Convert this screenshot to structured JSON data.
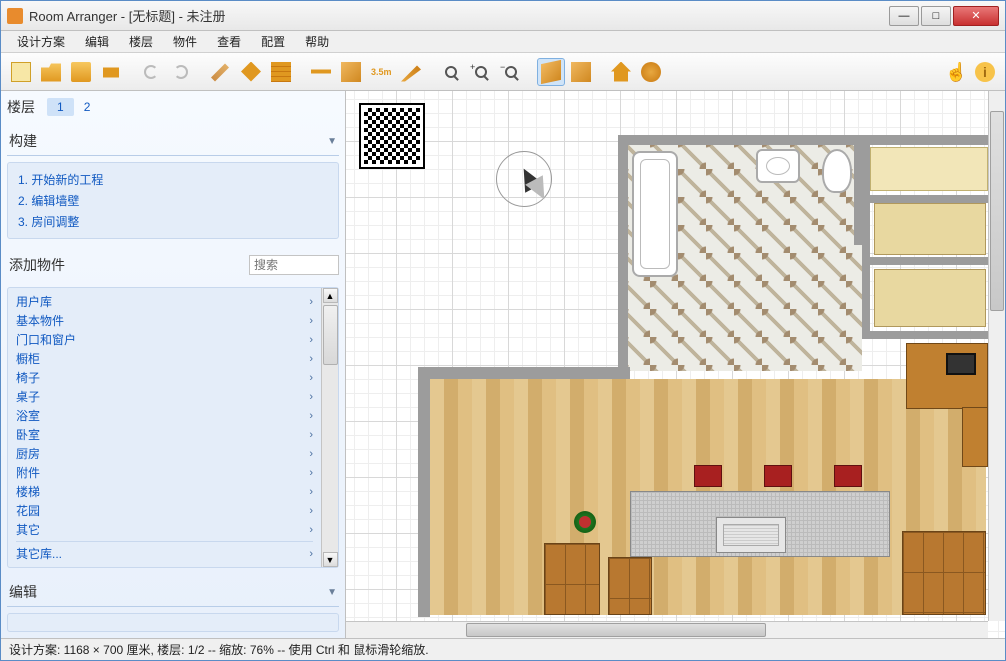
{
  "titlebar": {
    "app": "Room Arranger",
    "doc": "[无标题]",
    "suffix": "未注册"
  },
  "menu": [
    "设计方案",
    "编辑",
    "楼层",
    "物件",
    "查看",
    "配置",
    "帮助"
  ],
  "toolbar": {
    "items": [
      {
        "name": "new-project-button",
        "icon": "i-new"
      },
      {
        "name": "open-button",
        "icon": "i-open"
      },
      {
        "name": "save-button",
        "icon": "i-save"
      },
      {
        "name": "print-button",
        "icon": "i-print"
      },
      {
        "name": "sep"
      },
      {
        "name": "undo-button",
        "icon": "i-undo"
      },
      {
        "name": "redo-button",
        "icon": "i-redo"
      },
      {
        "name": "sep"
      },
      {
        "name": "paint-button",
        "icon": "i-brush"
      },
      {
        "name": "wall-button",
        "icon": "i-wall"
      },
      {
        "name": "brick-button",
        "icon": "i-brick"
      },
      {
        "name": "sep"
      },
      {
        "name": "dimension-button",
        "icon": "i-dim"
      },
      {
        "name": "object-button",
        "icon": "i-box"
      },
      {
        "name": "measure-button",
        "icon": "i-meas",
        "text": "3.5m"
      },
      {
        "name": "draw-button",
        "icon": "i-pen"
      },
      {
        "name": "sep"
      },
      {
        "name": "zoom-fit-button",
        "icon": "i-zoom"
      },
      {
        "name": "zoom-in-button",
        "icon": "i-zoom",
        "badge": "+"
      },
      {
        "name": "zoom-out-button",
        "icon": "i-zoom",
        "badge": "−"
      },
      {
        "name": "sep"
      },
      {
        "name": "view-3d-button",
        "icon": "i-3d",
        "active": true
      },
      {
        "name": "walkthrough-button",
        "icon": "i-box"
      },
      {
        "name": "sep"
      },
      {
        "name": "home-button",
        "icon": "i-house"
      },
      {
        "name": "settings-button",
        "icon": "i-gear"
      }
    ],
    "right": [
      {
        "name": "touch-button",
        "icon": "i-hand",
        "glyph": "☝"
      },
      {
        "name": "info-button",
        "icon": "i-info",
        "glyph": "i"
      }
    ]
  },
  "sidebar": {
    "floor_label": "楼层",
    "floors": [
      "1",
      "2"
    ],
    "active_floor": 0,
    "build_head": "构建",
    "build_items": [
      "1.  开始新的工程",
      "2.  编辑墙壁",
      "3.  房间调整"
    ],
    "add_head": "添加物件",
    "search_placeholder": "搜索",
    "objects": [
      "用户库",
      "基本物件",
      "门口和窗户",
      "橱柜",
      "椅子",
      "桌子",
      "浴室",
      "卧室",
      "厨房",
      "附件",
      "楼梯",
      "花园",
      "其它"
    ],
    "objects_extra": "其它库...",
    "edit_head": "编辑"
  },
  "status": {
    "text": "设计方案: 1168 × 700 厘米, 楼层: 1/2 -- 缩放: 76% -- 使用 Ctrl 和 鼠标滑轮缩放."
  }
}
